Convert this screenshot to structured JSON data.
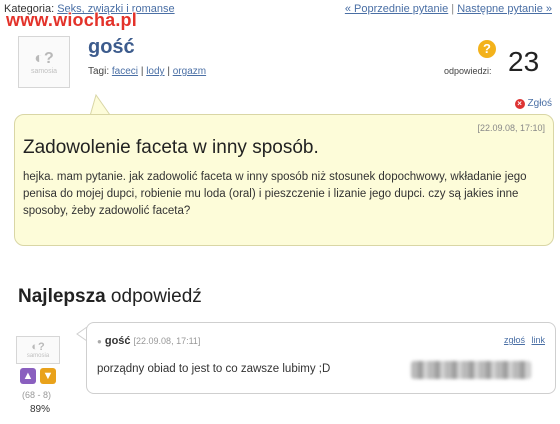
{
  "header": {
    "category_label": "Kategoria:",
    "category_link": "Seks, związki i romanse",
    "prev_question": "« Poprzednie pytanie",
    "separator": "|",
    "next_question": "Następne pytanie »"
  },
  "watermark": "www.wiocha.pl",
  "question_author": {
    "avatar_text": "samosia",
    "name": "gość",
    "tags_label": "Tagi:",
    "tags": [
      "faceci",
      "lody",
      "orgazm"
    ],
    "tag_separator": "|"
  },
  "answers": {
    "label": "odpowiedzi:",
    "count": "23",
    "icon_glyph": "?"
  },
  "report_label": "Zgłoś",
  "question": {
    "date": "[22.09.08, 17:10]",
    "title": "Zadowolenie faceta w inny sposób.",
    "body": "hejka. mam pytanie. jak zadowolić faceta w inny sposób niż stosunek dopochwowy, wkładanie jego penisa do mojej dupci, robienie mu loda (oral) i pieszczenie i lizanie jego dupci. czy są jakies inne sposoby, żeby zadowolić faceta?"
  },
  "best_answer": {
    "title_bold": "Najlepsza",
    "title_rest": " odpowiedź",
    "avatar_text": "samosia",
    "author": "gość",
    "date": "[22.09.08, 17:11]",
    "report": "zgłoś",
    "link": "link",
    "text": "porządny obiad to jest to co zawsze lubimy ;D",
    "votes": "(68 - 8)",
    "percent": "89%"
  },
  "icons": {
    "report": "report-icon",
    "answers": "question-icon",
    "thumb_up": "thumb-up-icon",
    "thumb_down": "thumb-down-icon"
  },
  "colors": {
    "link": "#4a6fa5",
    "question_bg": "#fdfcd9",
    "answers_badge": "#f3b21b",
    "watermark": "#e3322a"
  }
}
